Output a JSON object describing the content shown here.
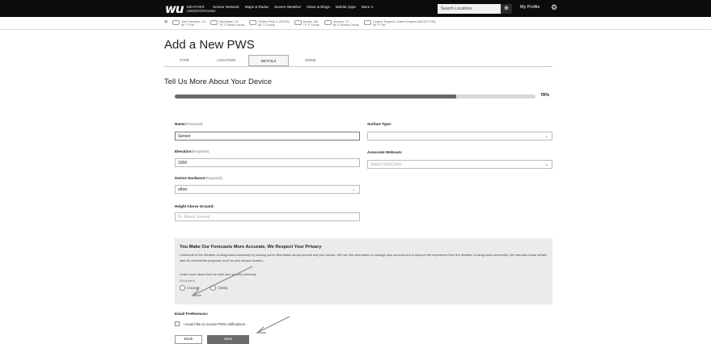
{
  "header": {
    "logo_mark": "wu",
    "logo_text": "WEATHER UNDERGROUND",
    "nav": [
      "Sensor Network",
      "Maps & Radar",
      "Severe Weather",
      "News & Blogs",
      "Mobile Apps",
      "More ∨"
    ],
    "search_placeholder": "Search Locations",
    "profile_label": "My Profile"
  },
  "city_bar": [
    {
      "name": "San Francisco, CA",
      "temp": "66 °F Fair"
    },
    {
      "name": "Manhattan, NY",
      "temp": "78 °F Partly Cloudy"
    },
    {
      "name": "Schiller Park, IL (60176)",
      "temp": "68 °F Cloudy"
    },
    {
      "name": "Boston, MA",
      "temp": "74 °F Sunny"
    },
    {
      "name": "Houston, TX",
      "temp": "88 °F Mostly Cloudy"
    },
    {
      "name": "London, England, United Kingdom (WCOH-TDB)",
      "temp": "66 °F Fair"
    }
  ],
  "page_title": "Add a New PWS",
  "tabs": [
    {
      "label": "TYPE"
    },
    {
      "label": "LOCATION"
    },
    {
      "label": "DETAILS"
    },
    {
      "label": "DONE"
    }
  ],
  "section_title": "Tell Us More About Your Device",
  "progress": {
    "percent": 78,
    "label": "78%"
  },
  "form": {
    "name_label": "Name",
    "name_req": "(Required)",
    "name_value": "Sensor",
    "elevation_label": "Elevation",
    "elevation_req": "(Required)",
    "elevation_value": "1000",
    "hardware_label": "Device Hardware",
    "hardware_req": "(Required)",
    "hardware_value": "other",
    "height_label": "Height Above Ground:",
    "height_placeholder": "Ft. Above Ground",
    "surface_label": "Surface Type:",
    "surface_value": "",
    "webcam_label": "Associate Webcam:",
    "webcam_value": "Select WebCams"
  },
  "privacy": {
    "title": "You Make Our Forecasts More Accurate, We Respect Your Privacy",
    "text": "Contribute to the Weather Underground community by sharing some information about yourself and your sensor. We use this information to manage your account and to improve the experience from the Weather Underground community. We may also share certain data for commercial purposes, such as your sensor location.",
    "link": "Learn more about how we take your privacy seriously",
    "required": "(Required)",
    "accept": "I Accept",
    "deny": "I Deny"
  },
  "email": {
    "label": "Email Preferences:",
    "checkbox": "I would like to receive PWS notifications."
  },
  "buttons": {
    "back": "Back",
    "next": "Next"
  },
  "colors": {
    "topbar": "#0c0c0c",
    "next_button": "#6b6b6b",
    "panel": "#ebebeb"
  }
}
